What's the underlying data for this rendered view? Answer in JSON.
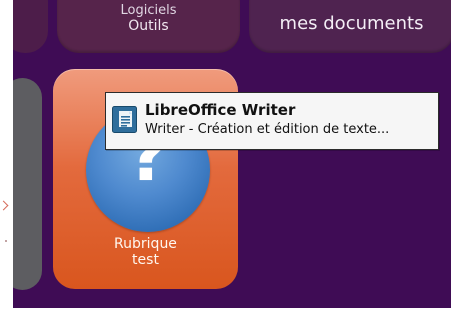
{
  "tiles": {
    "logiciels": {
      "line1": "Logiciels",
      "line2": "Outils"
    },
    "docs": {
      "label": "mes documents"
    },
    "rubrique": {
      "line1": "Rubrique",
      "line2": "test",
      "icon": "question-icon"
    }
  },
  "tooltip": {
    "title": "LibreOffice Writer",
    "description": "Writer - Création et édition de texte...",
    "icon": "document-icon"
  },
  "colors": {
    "background": "#3f0c55",
    "tile_orange": "#d9561e",
    "help_blue": "#4f8acf",
    "tooltip_bg": "#f6f6f6"
  }
}
